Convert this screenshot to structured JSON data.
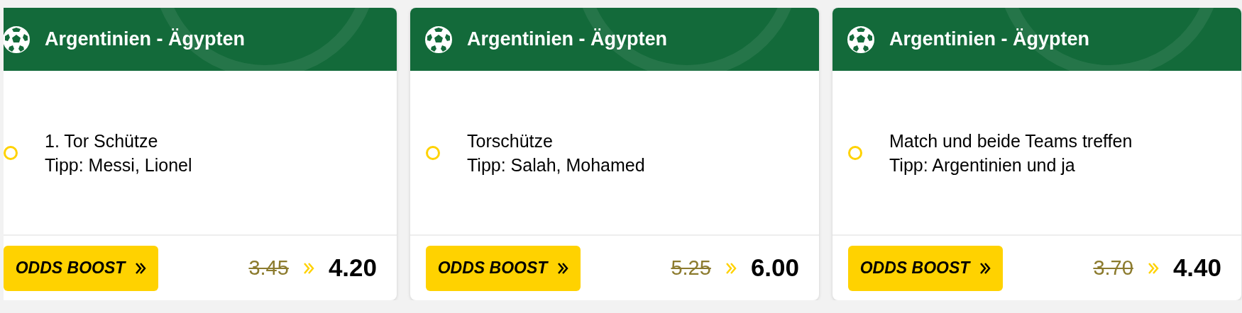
{
  "cards": [
    {
      "title": "Argentinien - Ägypten",
      "market": "1. Tor Schütze",
      "tip": "Tipp: Messi, Lionel",
      "selected": false,
      "boost_label": "ODDS BOOST",
      "old_odds": "3.45",
      "new_odds": "4.20"
    },
    {
      "title": "Argentinien - Ägypten",
      "market": "Torschütze",
      "tip": "Tipp: Salah, Mohamed",
      "selected": false,
      "boost_label": "ODDS BOOST",
      "old_odds": "5.25",
      "new_odds": "6.00"
    },
    {
      "title": "Argentinien - Ägypten",
      "market": "Match und beide Teams treffen",
      "tip": "Tipp: Argentinien und ja",
      "selected": false,
      "boost_label": "ODDS BOOST",
      "old_odds": "3.70",
      "new_odds": "4.40"
    }
  ]
}
